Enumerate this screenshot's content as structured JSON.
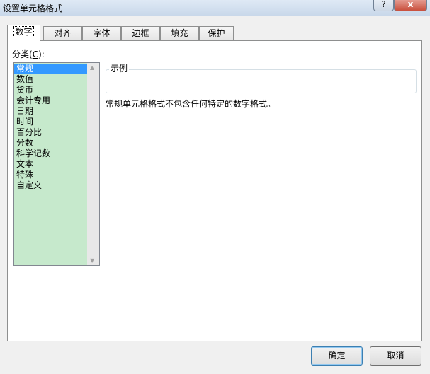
{
  "window": {
    "title": "设置单元格格式",
    "help_label": "?",
    "close_label": "x"
  },
  "tabs": [
    {
      "label": "数字",
      "active": true
    },
    {
      "label": "对齐"
    },
    {
      "label": "字体"
    },
    {
      "label": "边框"
    },
    {
      "label": "填充"
    },
    {
      "label": "保护"
    }
  ],
  "category": {
    "label_prefix": "分类(",
    "label_key": "C",
    "label_suffix": "):",
    "items": [
      "常规",
      "数值",
      "货币",
      "会计专用",
      "日期",
      "时间",
      "百分比",
      "分数",
      "科学记数",
      "文本",
      "特殊",
      "自定义"
    ],
    "selected": "常规"
  },
  "sample": {
    "label": "示例",
    "value": ""
  },
  "description": "常规单元格格式不包含任何特定的数字格式。",
  "buttons": {
    "ok": "确定",
    "cancel": "取消"
  },
  "colors": {
    "list_bg": "#c6e9cc",
    "selection": "#3399ff"
  }
}
